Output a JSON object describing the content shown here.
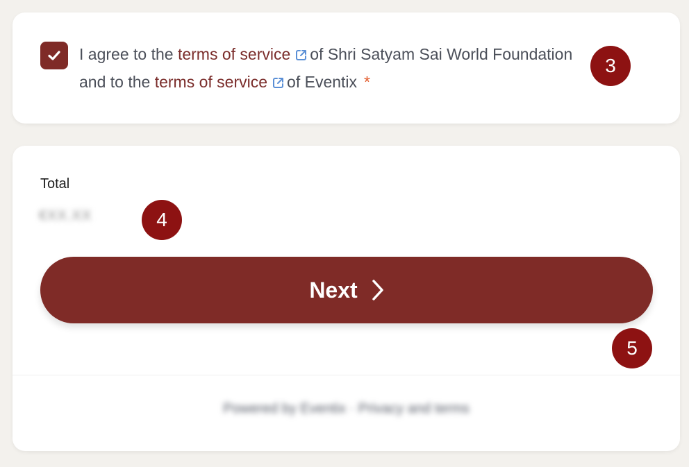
{
  "colors": {
    "accent": "#7f2b27",
    "accent_text": "#7a2c2a",
    "link_icon": "#5a8fd6",
    "required": "#e25a2a",
    "badge": "#8d1212"
  },
  "agreement": {
    "checked": true,
    "check_icon": "checkmark-icon",
    "part1": "I agree to the ",
    "link1": "terms of service",
    "part2": "of Shri Satyam Sai World Foundation and to the ",
    "link2": "terms of service",
    "part3": "of Eventix",
    "required_mark": "*",
    "external_icon": "external-link-icon"
  },
  "summary": {
    "total_label": "Total",
    "total_amount": "€XX.XX",
    "next_label": "Next",
    "next_icon": "chevron-right-icon",
    "footer_text": "Powered by Eventix · Privacy and terms"
  },
  "annotations": {
    "badge_3": "3",
    "badge_4": "4",
    "badge_5": "5"
  }
}
